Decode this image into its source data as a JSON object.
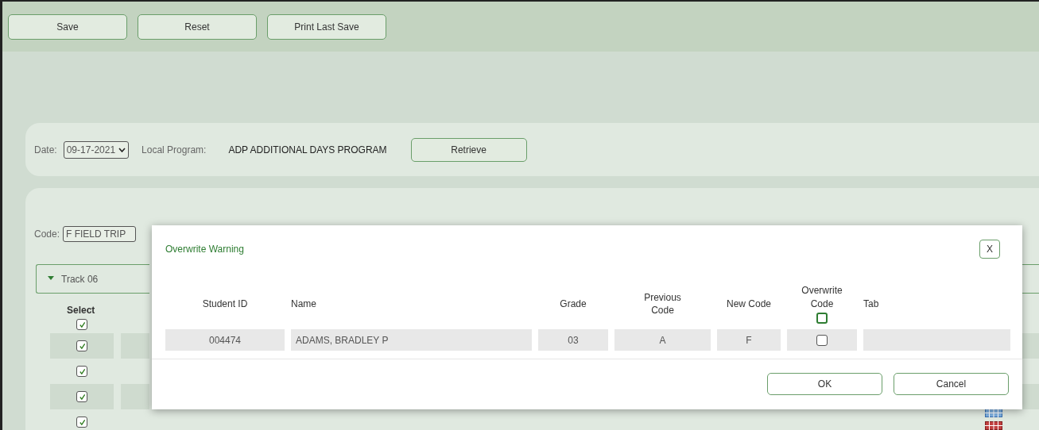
{
  "toolbar": {
    "buttons": [
      "Save",
      "Reset",
      "Print Last Save"
    ]
  },
  "filter": {
    "date_label": "Date:",
    "date": "09-17-2021",
    "program_label": "Local Program:",
    "program": "ADP ADDITIONAL DAYS PROGRAM",
    "button": "Retrieve"
  },
  "code": {
    "label": "Code:",
    "value": "F FIELD TRIP"
  },
  "track": {
    "label": "Track 06",
    "expanded": true
  },
  "roster": {
    "select_header": "Select",
    "rows": [
      {
        "checked": true
      },
      {
        "checked": true
      },
      {
        "checked": true
      },
      {
        "checked": true
      },
      {
        "checked": true
      }
    ]
  },
  "dialog": {
    "title": "Overwrite Warning",
    "close": "X",
    "columns": [
      "Student ID",
      "Name",
      "Grade",
      "Previous Code",
      "New Code",
      "Overwrite Code",
      "Tab"
    ],
    "select_all_checked": false,
    "rows": [
      {
        "student_id": "004474",
        "name": "ADAMS, BRADLEY P",
        "grade": "03",
        "previous_code": "A",
        "new_code": "F",
        "overwrite": false
      }
    ],
    "buttons": [
      "OK",
      "Cancel"
    ]
  }
}
